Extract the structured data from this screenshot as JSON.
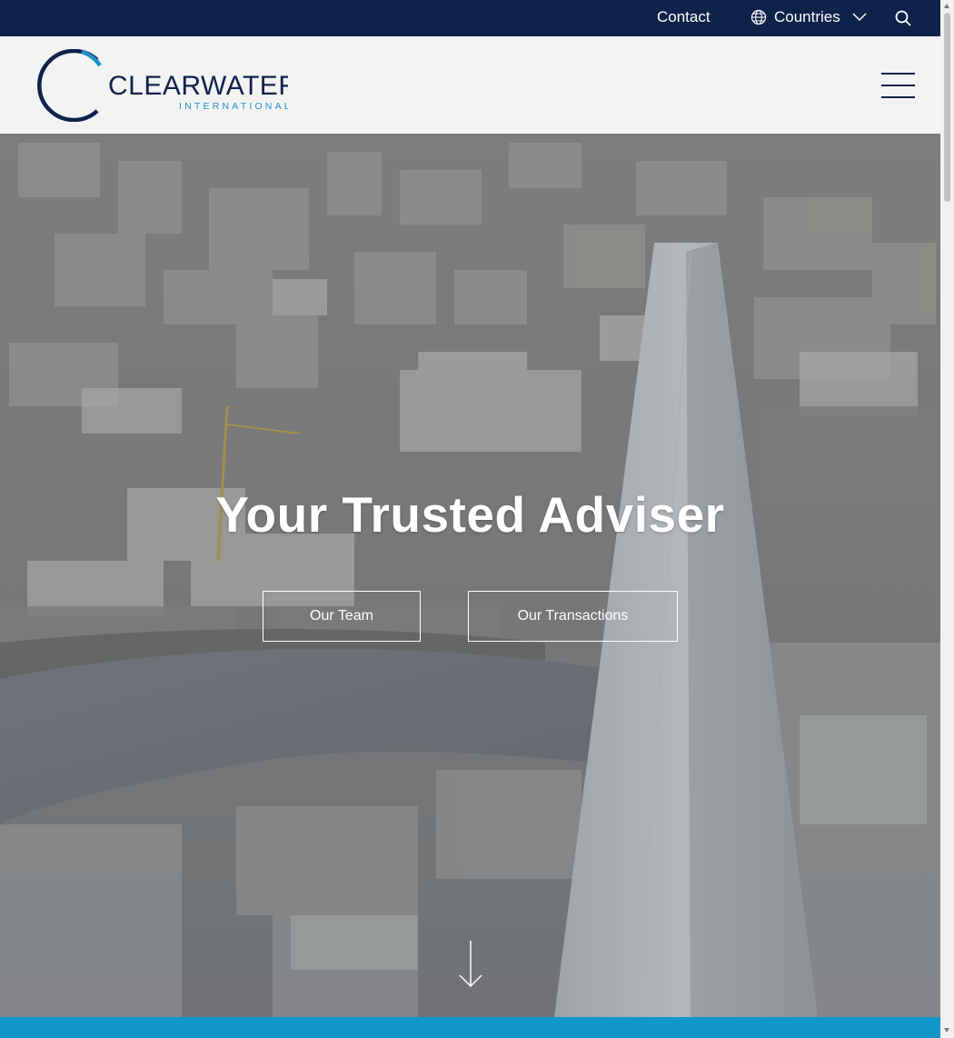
{
  "topbar": {
    "contact_label": "Contact",
    "countries_label": "Countries",
    "icons": {
      "globe": "globe-icon",
      "chevron": "chevron-down-icon",
      "search": "search-icon"
    }
  },
  "header": {
    "logo_text": "CLEARWATER",
    "logo_subtext": "INTERNATIONAL",
    "menu_icon": "hamburger-menu-icon"
  },
  "hero": {
    "title": "Your Trusted Adviser",
    "buttons": [
      {
        "label": "Our Team"
      },
      {
        "label": "Our Transactions"
      }
    ],
    "scroll_icon": "arrow-down-icon"
  },
  "colors": {
    "navy": "#0f2249",
    "accent_blue": "#1f8fc7",
    "band_blue": "#0f97c7",
    "header_bg": "#f3f3f3"
  }
}
